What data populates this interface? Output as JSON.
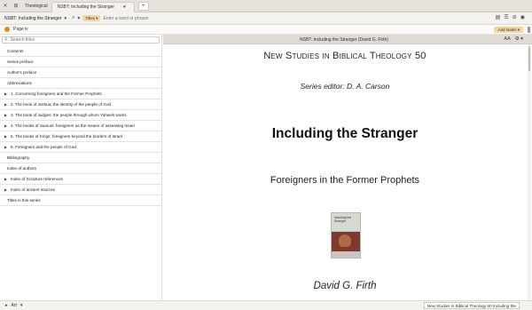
{
  "tabs": {
    "close_glyph": "✕",
    "grid_glyph": "⊞",
    "workspace_label": "Theological",
    "active_tab_label": "NSBT: Including the Stranger",
    "active_tab_menu": "▾",
    "new_tab": "+"
  },
  "toolbar": {
    "resource_title": "NSBT: Including the Stranger",
    "resource_chevron": "▾",
    "search_key_icon": "⌕",
    "search_scope_chevron": "▾",
    "scope_chip": "Titles ▾",
    "search_placeholder": "Enter a word or phrase",
    "right_icons": [
      "▤",
      "☰",
      "⊘",
      "◉"
    ]
  },
  "subbar": {
    "page_label": "Page iv",
    "add_notes": "Add Notes ▾"
  },
  "sidebar": {
    "search_placeholder": "Search titles",
    "items": [
      {
        "label": "Contents",
        "expand": false
      },
      {
        "label": "Series preface",
        "expand": false
      },
      {
        "label": "Author's preface",
        "expand": false
      },
      {
        "label": "Abbreviations",
        "expand": false
      },
      {
        "label": "1. Concerning foreigners and the Former Prophets",
        "expand": true
      },
      {
        "label": "2. The book of Joshua: the identity of the people of God",
        "expand": true
      },
      {
        "label": "3. The book of Judges: the people through whom Yahweh works",
        "expand": true
      },
      {
        "label": "4. The books of Samuel: foreigners as the means of assessing Israel",
        "expand": true
      },
      {
        "label": "5. The books of Kings: foreigners beyond the borders of Israel",
        "expand": true
      },
      {
        "label": "6. Foreigners and the people of God",
        "expand": true
      },
      {
        "label": "Bibliography",
        "expand": false
      },
      {
        "label": "Index of authors",
        "expand": false
      },
      {
        "label": "Index of Scripture references",
        "expand": true
      },
      {
        "label": "Index of ancient sources",
        "expand": true
      },
      {
        "label": "Titles in this series",
        "expand": false
      }
    ]
  },
  "reader": {
    "header_title": "NSBT: Including the Stranger (David G. Firth)",
    "font_size_icon": "AA",
    "settings_icon": "⚙ ▾"
  },
  "page": {
    "series": "New Studies in Biblical Theology 50",
    "editor": "Series editor: D. A. Carson",
    "title": "Including the Stranger",
    "subtitle": "Foreigners in the Former Prophets",
    "cover_title": "Including the Stranger",
    "cover_subtitle": "Foreigners in the Former Prophets",
    "author": "David G. Firth"
  },
  "statusbar": {
    "tool_label": "Art",
    "tool_chevron": "▾",
    "current_location": "New Studies in Biblical Theology 50 Including the"
  },
  "colors": {
    "accent": "#e08a2c",
    "chip": "#f2d7a0"
  }
}
